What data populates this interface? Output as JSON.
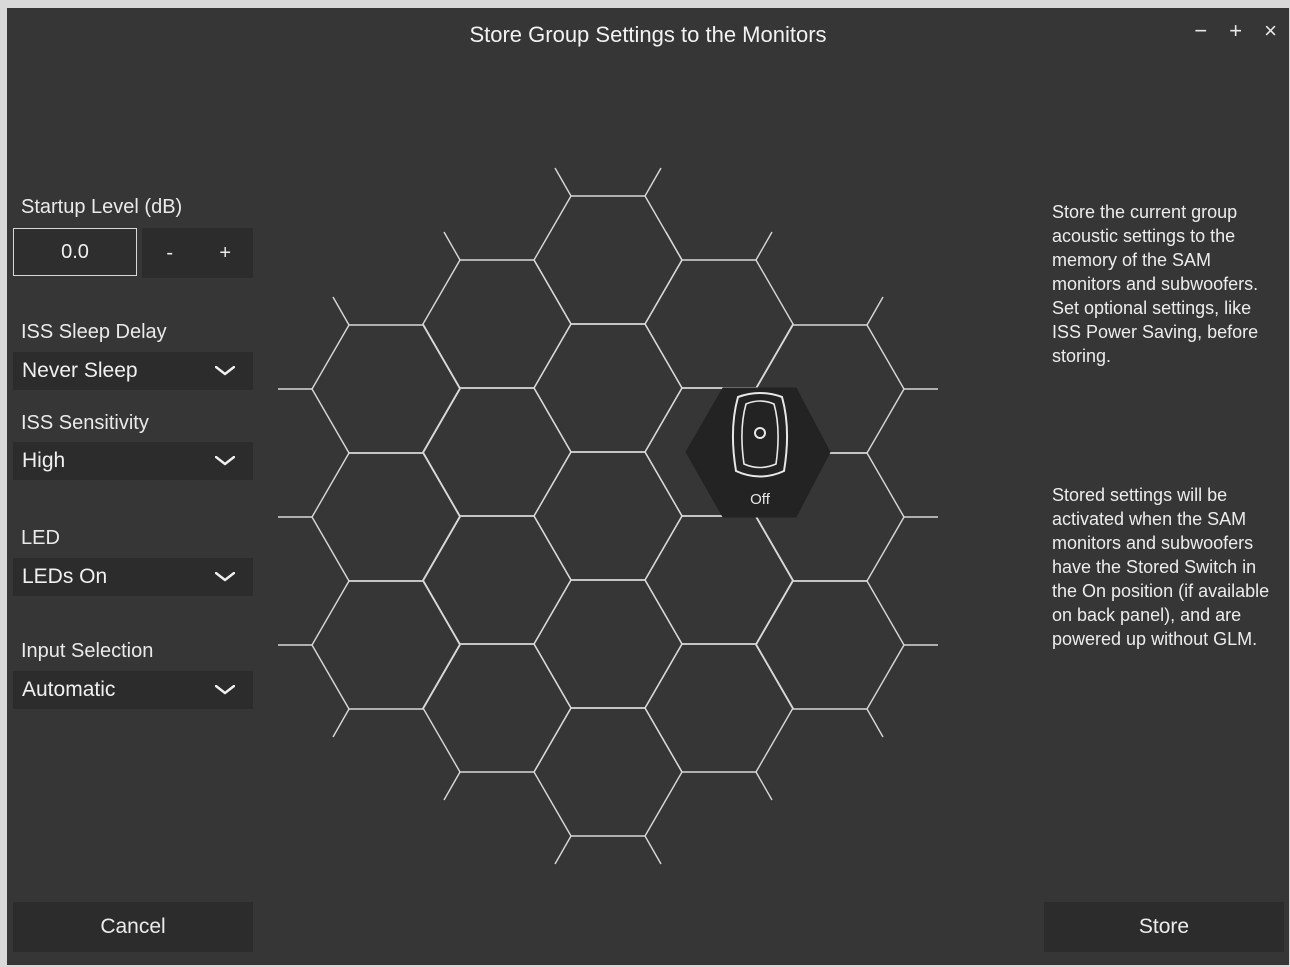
{
  "window": {
    "title": "Store Group Settings to the Monitors",
    "controls": {
      "minimize": "−",
      "maximize": "+",
      "close": "×"
    }
  },
  "settings": {
    "startup_level": {
      "label": "Startup Level (dB)",
      "value": "0.0",
      "decrement": "-",
      "increment": "+"
    },
    "iss_sleep_delay": {
      "label": "ISS Sleep Delay",
      "value": "Never Sleep"
    },
    "iss_sensitivity": {
      "label": "ISS Sensitivity",
      "value": "High"
    },
    "led": {
      "label": "LED",
      "value": "LEDs On"
    },
    "input_selection": {
      "label": "Input Selection",
      "value": "Automatic"
    }
  },
  "monitor": {
    "status": "Off",
    "icon": "speaker-monitor-icon"
  },
  "description": {
    "paragraph1": "Store the current group acoustic settings to the memory of the SAM monitors and subwoofers. Set optional settings, like ISS Power Saving, before storing.",
    "paragraph2": "Stored settings will be activated when the SAM monitors and subwoofers have the Stored Switch in the On position (if available on back panel), and are powered up without GLM."
  },
  "buttons": {
    "cancel": "Cancel",
    "store": "Store"
  },
  "colors": {
    "background": "#363636",
    "panel": "#2c2c2c",
    "hex_stroke": "#d9d9d9",
    "selected_hex": "#232323"
  }
}
